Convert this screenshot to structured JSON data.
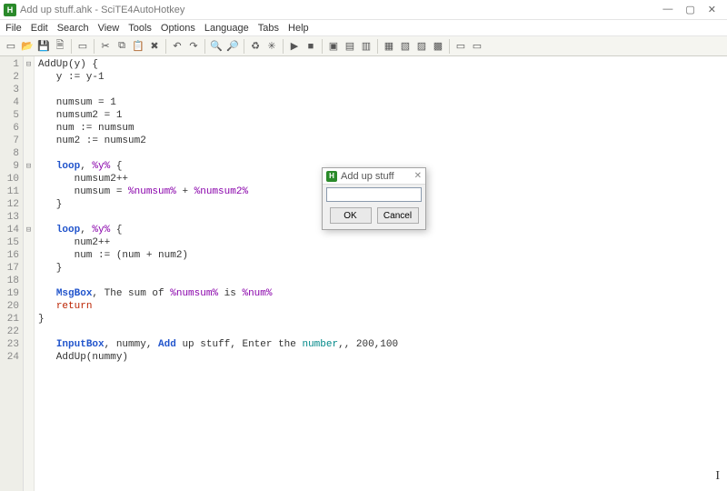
{
  "window": {
    "title": "Add up stuff.ahk - SciTE4AutoHotkey"
  },
  "menu": [
    "File",
    "Edit",
    "Search",
    "View",
    "Tools",
    "Options",
    "Language",
    "Tabs",
    "Help"
  ],
  "toolbar": {
    "groups": [
      [
        "new-icon",
        "open-icon",
        "save-icon",
        "saveall-icon"
      ],
      [
        "print-icon"
      ],
      [
        "cut-icon",
        "copy-icon",
        "paste-icon",
        "delete-icon"
      ],
      [
        "undo-icon",
        "redo-icon"
      ],
      [
        "find-icon",
        "replace-icon"
      ],
      [
        "refresh-icon",
        "toggle-icon"
      ],
      [
        "run-icon",
        "stop-icon"
      ],
      [
        "window1-icon",
        "window2-icon",
        "window3-icon"
      ],
      [
        "panel1-icon",
        "panel2-icon",
        "panel3-icon",
        "panel4-icon"
      ],
      [
        "extra1-icon",
        "extra2-icon"
      ]
    ],
    "glyphs": {
      "new-icon": "▭",
      "open-icon": "📂",
      "save-icon": "💾",
      "saveall-icon": "🗎",
      "print-icon": "▭",
      "cut-icon": "✂",
      "copy-icon": "⧉",
      "paste-icon": "📋",
      "delete-icon": "✖",
      "undo-icon": "↶",
      "redo-icon": "↷",
      "find-icon": "🔍",
      "replace-icon": "🔎",
      "refresh-icon": "♻",
      "toggle-icon": "✳",
      "run-icon": "▶",
      "stop-icon": "■",
      "window1-icon": "▣",
      "window2-icon": "▤",
      "window3-icon": "▥",
      "panel1-icon": "▦",
      "panel2-icon": "▧",
      "panel3-icon": "▨",
      "panel4-icon": "▩",
      "extra1-icon": "▭",
      "extra2-icon": "▭"
    }
  },
  "code": {
    "lines": [
      [
        {
          "t": "AddUp(y) {",
          "c": ""
        }
      ],
      [
        {
          "t": "   y := y-1",
          "c": ""
        }
      ],
      [
        {
          "t": "",
          "c": ""
        }
      ],
      [
        {
          "t": "   numsum = 1",
          "c": ""
        }
      ],
      [
        {
          "t": "   numsum2 = 1",
          "c": ""
        }
      ],
      [
        {
          "t": "   num := numsum",
          "c": ""
        }
      ],
      [
        {
          "t": "   num2 := numsum2",
          "c": ""
        }
      ],
      [
        {
          "t": "",
          "c": ""
        }
      ],
      [
        {
          "t": "   ",
          "c": ""
        },
        {
          "t": "loop",
          "c": "c-blue"
        },
        {
          "t": ", ",
          "c": ""
        },
        {
          "t": "%y%",
          "c": "c-purple"
        },
        {
          "t": " {",
          "c": ""
        }
      ],
      [
        {
          "t": "      numsum2++",
          "c": ""
        }
      ],
      [
        {
          "t": "      numsum = ",
          "c": ""
        },
        {
          "t": "%numsum%",
          "c": "c-purple"
        },
        {
          "t": " + ",
          "c": ""
        },
        {
          "t": "%numsum2%",
          "c": "c-purple"
        }
      ],
      [
        {
          "t": "   }",
          "c": ""
        }
      ],
      [
        {
          "t": "",
          "c": ""
        }
      ],
      [
        {
          "t": "   ",
          "c": ""
        },
        {
          "t": "loop",
          "c": "c-blue"
        },
        {
          "t": ", ",
          "c": ""
        },
        {
          "t": "%y%",
          "c": "c-purple"
        },
        {
          "t": " {",
          "c": ""
        }
      ],
      [
        {
          "t": "      num2++",
          "c": ""
        }
      ],
      [
        {
          "t": "      num := (num + num2)",
          "c": ""
        }
      ],
      [
        {
          "t": "   }",
          "c": ""
        }
      ],
      [
        {
          "t": "",
          "c": ""
        }
      ],
      [
        {
          "t": "   ",
          "c": ""
        },
        {
          "t": "MsgBox",
          "c": "c-blue"
        },
        {
          "t": ", The sum of ",
          "c": ""
        },
        {
          "t": "%numsum%",
          "c": "c-purple"
        },
        {
          "t": " is ",
          "c": ""
        },
        {
          "t": "%num%",
          "c": "c-purple"
        }
      ],
      [
        {
          "t": "   ",
          "c": ""
        },
        {
          "t": "return",
          "c": "c-red"
        }
      ],
      [
        {
          "t": "}",
          "c": ""
        }
      ],
      [
        {
          "t": "",
          "c": ""
        }
      ],
      [
        {
          "t": "   ",
          "c": ""
        },
        {
          "t": "InputBox",
          "c": "c-blue"
        },
        {
          "t": ", nummy, ",
          "c": ""
        },
        {
          "t": "Add",
          "c": "c-blue"
        },
        {
          "t": " up stuff, Enter the ",
          "c": ""
        },
        {
          "t": "number",
          "c": "c-teal"
        },
        {
          "t": ",, 200,100",
          "c": ""
        }
      ],
      [
        {
          "t": "   AddUp(nummy)",
          "c": ""
        }
      ]
    ],
    "fold": {
      "1": "⊟",
      "9": "⊟",
      "14": "⊟"
    }
  },
  "dialog": {
    "title": "Add up stuff",
    "input_value": "",
    "ok": "OK",
    "cancel": "Cancel"
  }
}
